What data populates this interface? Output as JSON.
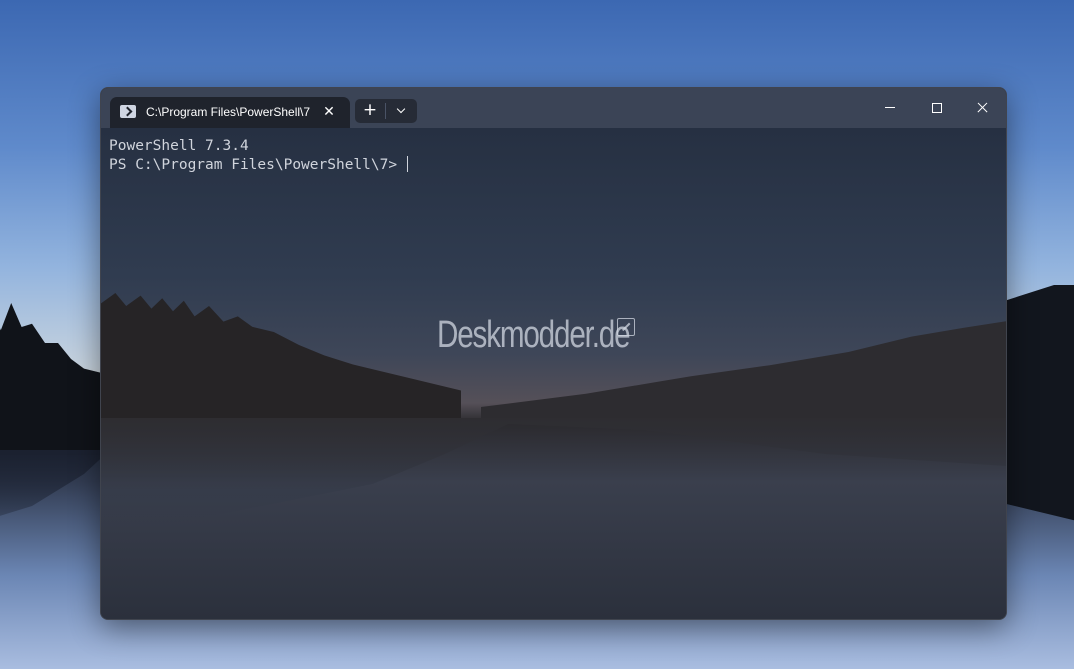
{
  "window": {
    "tab_title": "C:\\Program Files\\PowerShell\\7",
    "icons": {
      "tab": "powershell-icon",
      "close": "close-icon",
      "new_tab": "plus-icon",
      "dropdown": "chevron-down-icon",
      "minimize": "minimize-icon",
      "maximize": "maximize-icon",
      "window_close": "close-icon"
    },
    "new_tab_label": "+",
    "tab_close_label": "✕"
  },
  "terminal": {
    "lines": [
      "PowerShell 7.3.4",
      "PS C:\\Program Files\\PowerShell\\7> "
    ]
  },
  "watermark": {
    "text": "Deskmodder.de"
  },
  "colors": {
    "titlebar": "#3b4456",
    "active_tab": "#1f232c",
    "terminal_text": "#d0d4dc"
  }
}
